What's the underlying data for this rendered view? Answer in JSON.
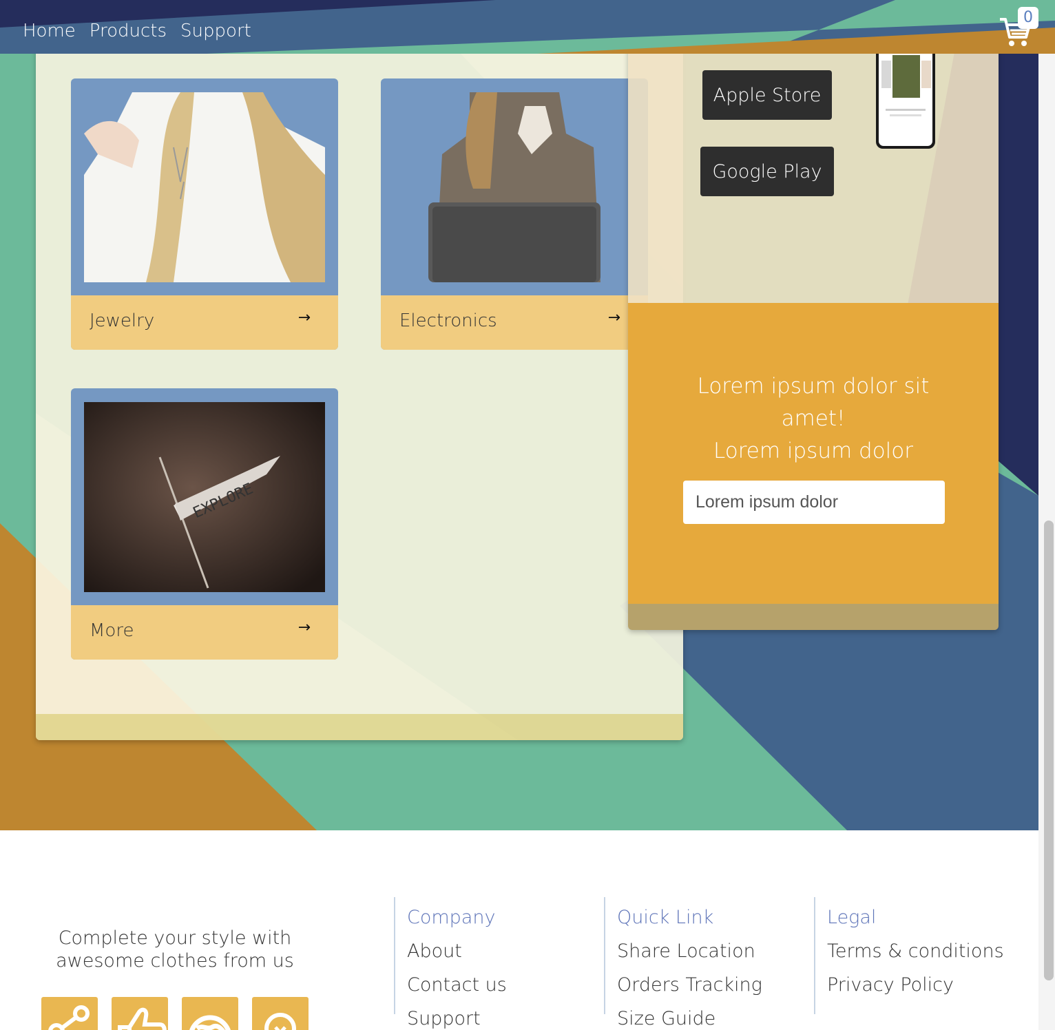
{
  "nav": {
    "links": [
      "Home",
      "Products",
      "Support"
    ],
    "cart_count": "0",
    "cart_icon": "shopping-cart-icon"
  },
  "categories": [
    {
      "label": "Jewelry",
      "image": "woman-with-necklace-photo",
      "arrow_icon": "arrow-right-icon"
    },
    {
      "label": "Electronics",
      "image": "woman-with-laptop-photo",
      "arrow_icon": "arrow-right-icon"
    },
    {
      "label": "More",
      "image": "explore-pennant-photo",
      "arrow_icon": "arrow-right-icon"
    }
  ],
  "app": {
    "apple_label": "Apple Store",
    "google_label": "Google Play",
    "phone_image": "phone-mockup-image"
  },
  "promo": {
    "line1": "Lorem ipsum dolor sit amet!",
    "line2": "Lorem ipsum dolor",
    "input_placeholder": "Lorem ipsum dolor"
  },
  "footer": {
    "tagline": "Complete your style with awesome clothes from us",
    "social_icons": [
      "share-icon",
      "thumbs-up-icon",
      "globe-icon",
      "lightbulb-icon"
    ],
    "columns": [
      {
        "heading": "Company",
        "links": [
          "About",
          "Contact us",
          "Support"
        ]
      },
      {
        "heading": "Quick Link",
        "links": [
          "Share Location",
          "Orders Tracking",
          "Size Guide"
        ]
      },
      {
        "heading": "Legal",
        "links": [
          "Terms & conditions",
          "Privacy Policy"
        ]
      }
    ]
  },
  "colors": {
    "navy": "#252d5c",
    "steel_blue": "#42648c",
    "teal": "#6cba9a",
    "ochre": "#be8630",
    "card_blue": "#7598c2",
    "card_bar": "#f1cc80",
    "promo_orange": "#e6a93c",
    "link_blue": "#5e74b8"
  }
}
